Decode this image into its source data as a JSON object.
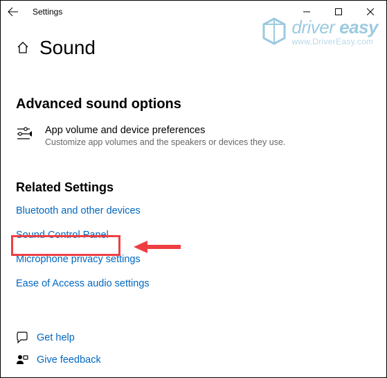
{
  "window": {
    "app_title": "Settings"
  },
  "header": {
    "page_title": "Sound"
  },
  "advanced": {
    "heading": "Advanced sound options",
    "pref_title": "App volume and device preferences",
    "pref_desc": "Customize app volumes and the speakers or devices they use."
  },
  "related": {
    "heading": "Related Settings",
    "links": {
      "bluetooth": "Bluetooth and other devices",
      "sound_cp": "Sound Control Panel",
      "mic_privacy": "Microphone privacy settings",
      "ease_access": "Ease of Access audio settings"
    }
  },
  "footer": {
    "get_help": "Get help",
    "feedback": "Give feedback"
  },
  "watermark": {
    "line1_a": "driver",
    "line1_b": "easy",
    "line2": "www.DriverEasy.com"
  }
}
